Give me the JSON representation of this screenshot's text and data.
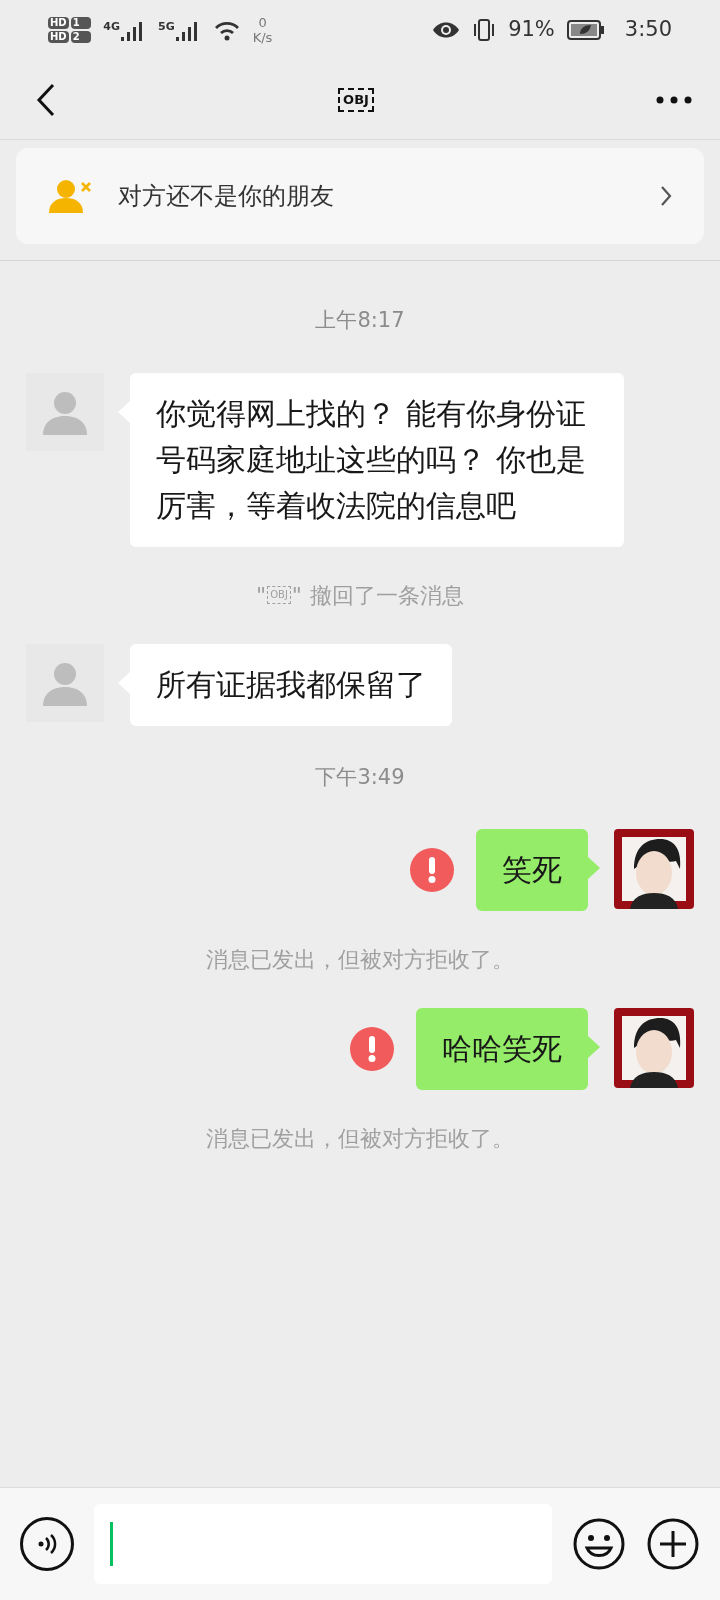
{
  "status_bar": {
    "sim_labels": [
      "HD",
      "1",
      "HD",
      "2"
    ],
    "networks": [
      "4G",
      "5G"
    ],
    "speed_value": "0",
    "speed_unit": "K/s",
    "battery": "91%",
    "time": "3:50"
  },
  "header": {
    "title": "OBJ"
  },
  "banner": {
    "text": "对方还不是你的朋友"
  },
  "messages": [
    {
      "kind": "time",
      "text": "上午8:17"
    },
    {
      "kind": "received",
      "text": "你觉得网上找的？ 能有你身份证号码家庭地址这些的吗？ 你也是厉害，等着收法院的信息吧"
    },
    {
      "kind": "recall",
      "quote_open": "\"",
      "name": "OBJ",
      "quote_close": "\"",
      "text": "撤回了一条消息"
    },
    {
      "kind": "received",
      "text": "所有证据我都保留了"
    },
    {
      "kind": "time",
      "text": "下午3:49"
    },
    {
      "kind": "sent",
      "text": "笑死",
      "failed": true
    },
    {
      "kind": "system",
      "text": "消息已发出，但被对方拒收了。"
    },
    {
      "kind": "sent",
      "text": "哈哈笑死",
      "failed": true
    },
    {
      "kind": "system",
      "text": "消息已发出，但被对方拒收了。"
    }
  ]
}
